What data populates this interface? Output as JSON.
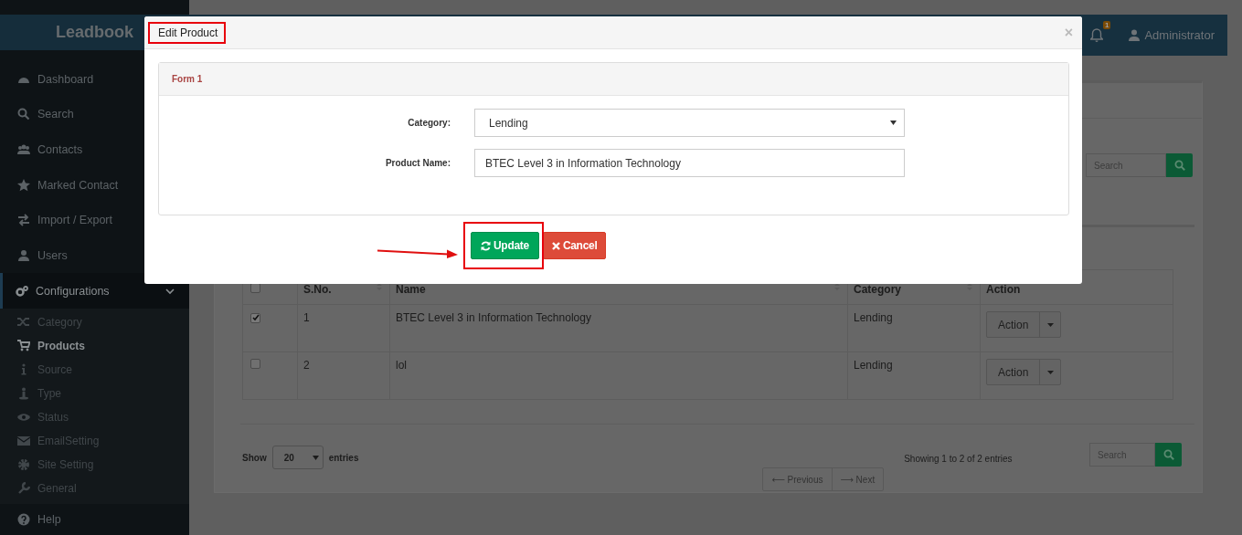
{
  "brand": "Leadbook",
  "topbar": {
    "notification_count": "1",
    "user": "Administrator"
  },
  "sidebar": {
    "items": [
      {
        "label": "Dashboard",
        "selected": false
      },
      {
        "label": "Search",
        "selected": false
      },
      {
        "label": "Contacts",
        "selected": false
      },
      {
        "label": "Marked Contact",
        "selected": false
      },
      {
        "label": "Import / Export",
        "selected": false
      },
      {
        "label": "Users",
        "selected": false
      },
      {
        "label": "Configurations",
        "selected": true,
        "expanded": true,
        "children": [
          {
            "label": "Category",
            "selected": false
          },
          {
            "label": "Products",
            "selected": true
          },
          {
            "label": "Source",
            "selected": false
          },
          {
            "label": "Type",
            "selected": false
          },
          {
            "label": "Status",
            "selected": false
          },
          {
            "label": "EmailSetting",
            "selected": false
          },
          {
            "label": "Site Setting",
            "selected": false
          },
          {
            "label": "General",
            "selected": false
          }
        ]
      },
      {
        "label": "Help",
        "selected": false
      }
    ]
  },
  "content": {
    "search": {
      "placeholder": "Search"
    },
    "table": {
      "columns": [
        "S.No.",
        "Name",
        "Category",
        "Action"
      ],
      "header_checked": false,
      "rows": [
        {
          "checked": true,
          "cells": [
            "1",
            "BTEC Level 3 in Information Technology",
            "Lending"
          ],
          "action": "Action"
        },
        {
          "checked": false,
          "cells": [
            "2",
            "lol",
            "Lending"
          ],
          "action": "Action"
        }
      ]
    },
    "footer": {
      "show_label": "Show",
      "page_size": "20",
      "entries_label": "entries",
      "pagination": [
        "⟵ Previous",
        "⟶ Next"
      ],
      "info": "Showing 1 to 2 of 2 entries",
      "search": {
        "placeholder": "Search"
      }
    }
  },
  "modal": {
    "title": "Edit Product",
    "close": "×",
    "form_title": "Form 1",
    "fields": [
      {
        "label": "Category:",
        "kind": "select",
        "value": "Lending"
      },
      {
        "label": "Product Name:",
        "kind": "text",
        "value": "BTEC Level 3 in Information Technology"
      }
    ],
    "buttons": [
      {
        "label": "Update",
        "kind": "primary"
      },
      {
        "label": "Cancel",
        "kind": "danger"
      }
    ]
  }
}
